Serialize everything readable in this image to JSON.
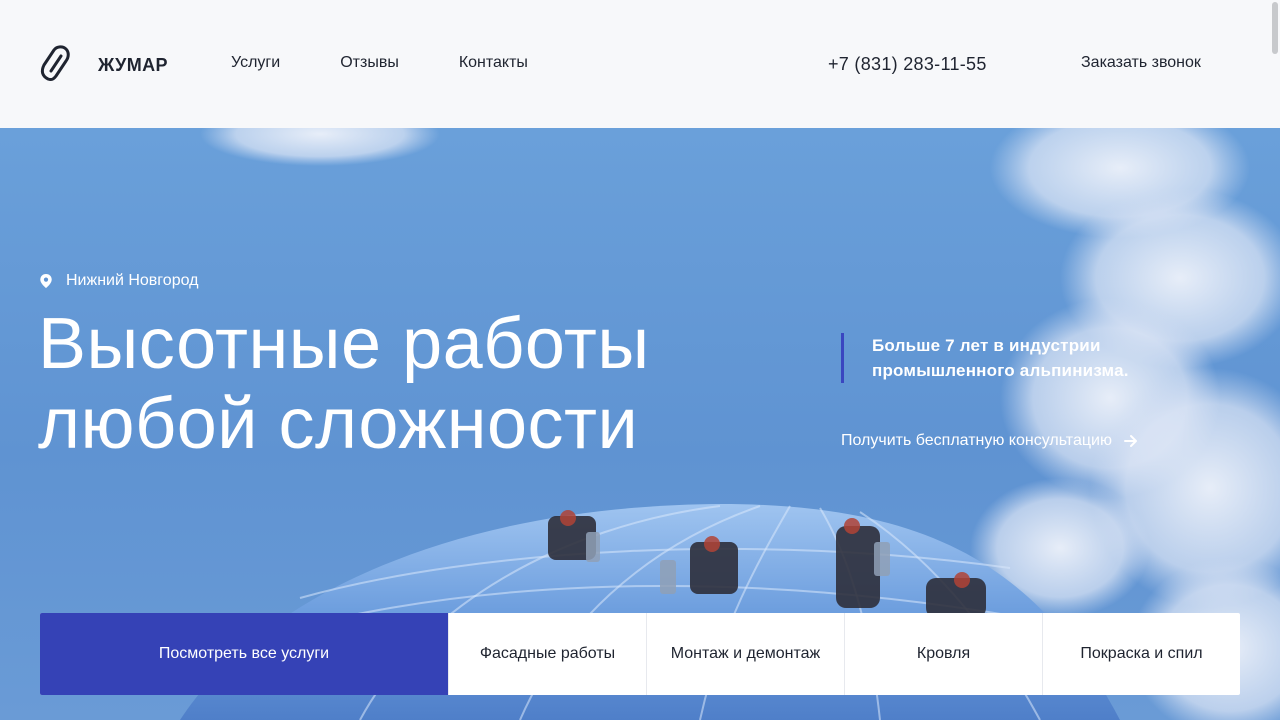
{
  "header": {
    "brand": "ЖУМАР",
    "nav": [
      "Услуги",
      "Отзывы",
      "Контакты"
    ],
    "phone": "+7 (831) 283-11-55",
    "callback_label": "Заказать звонок"
  },
  "hero": {
    "location": "Нижний Новгород",
    "headline_line1": "Высотные работы",
    "headline_line2": "любой сложности",
    "info_line1": "Больше 7 лет в индустрии",
    "info_line2": "промышленного альпинизма.",
    "consult_label": "Получить бесплатную консультацию"
  },
  "services": {
    "all_label": "Посмотреть все услуги",
    "items": [
      "Фасадные работы",
      "Монтаж и демонтаж",
      "Кровля",
      "Покраска и спил"
    ]
  },
  "icons": {
    "logo": "carabiner-icon",
    "location": "map-pin-icon",
    "consult": "arrow-right-icon"
  },
  "colors": {
    "primary": "#3542B6",
    "sky": "#5F93D2",
    "header_bg": "#F7F8FA",
    "text": "#1F2430"
  }
}
